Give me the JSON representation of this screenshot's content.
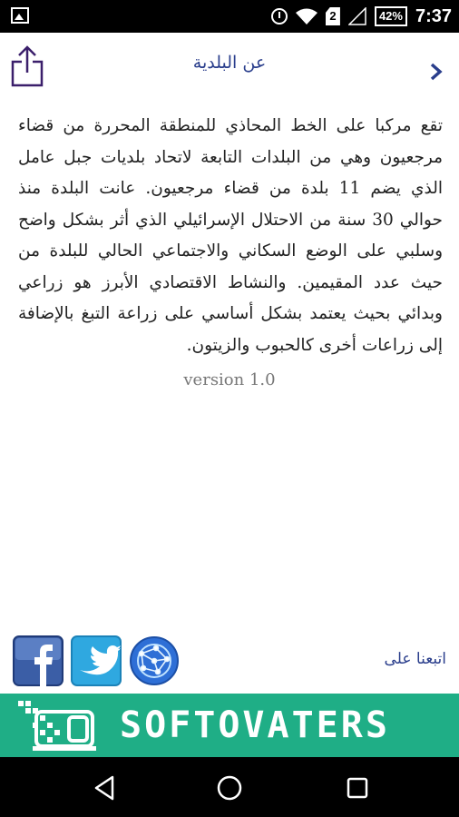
{
  "status_bar": {
    "sim_slot": "2",
    "battery": "42%",
    "time": "7:37"
  },
  "header": {
    "title": "عن البلدية",
    "share_icon": "share-icon",
    "back_icon": "chevron-right-icon"
  },
  "content": {
    "about": "تقع مركبا على الخط المحاذي للمنطقة المحررة من قضاء مرجعيون وهي من البلدات التابعة لاتحاد بلديات جبل عامل الذي يضم 11 بلدة من قضاء مرجعيون. عانت البلدة منذ حوالي 30 سنة من الاحتلال الإسرائيلي الذي أثر بشكل واضح وسلبي على الوضع السكاني والاجتماعي الحالي للبلدة من حيث عدد المقيمين. والنشاط الاقتصادي الأبرز هو زراعي وبدائي بحيث يعتمد بشكل أساسي على زراعة التبغ بالإضافة إلى زراعات أخرى كالحبوب والزيتون.",
    "version": "version 1.0"
  },
  "footer": {
    "follow_label": "اتبعنا على",
    "social": [
      "facebook-icon",
      "twitter-icon",
      "globe-icon"
    ],
    "brand_name": "SOFTOVATERS",
    "brand_color": "#1fae86"
  },
  "nav": [
    "back-icon",
    "home-icon",
    "recents-icon"
  ]
}
